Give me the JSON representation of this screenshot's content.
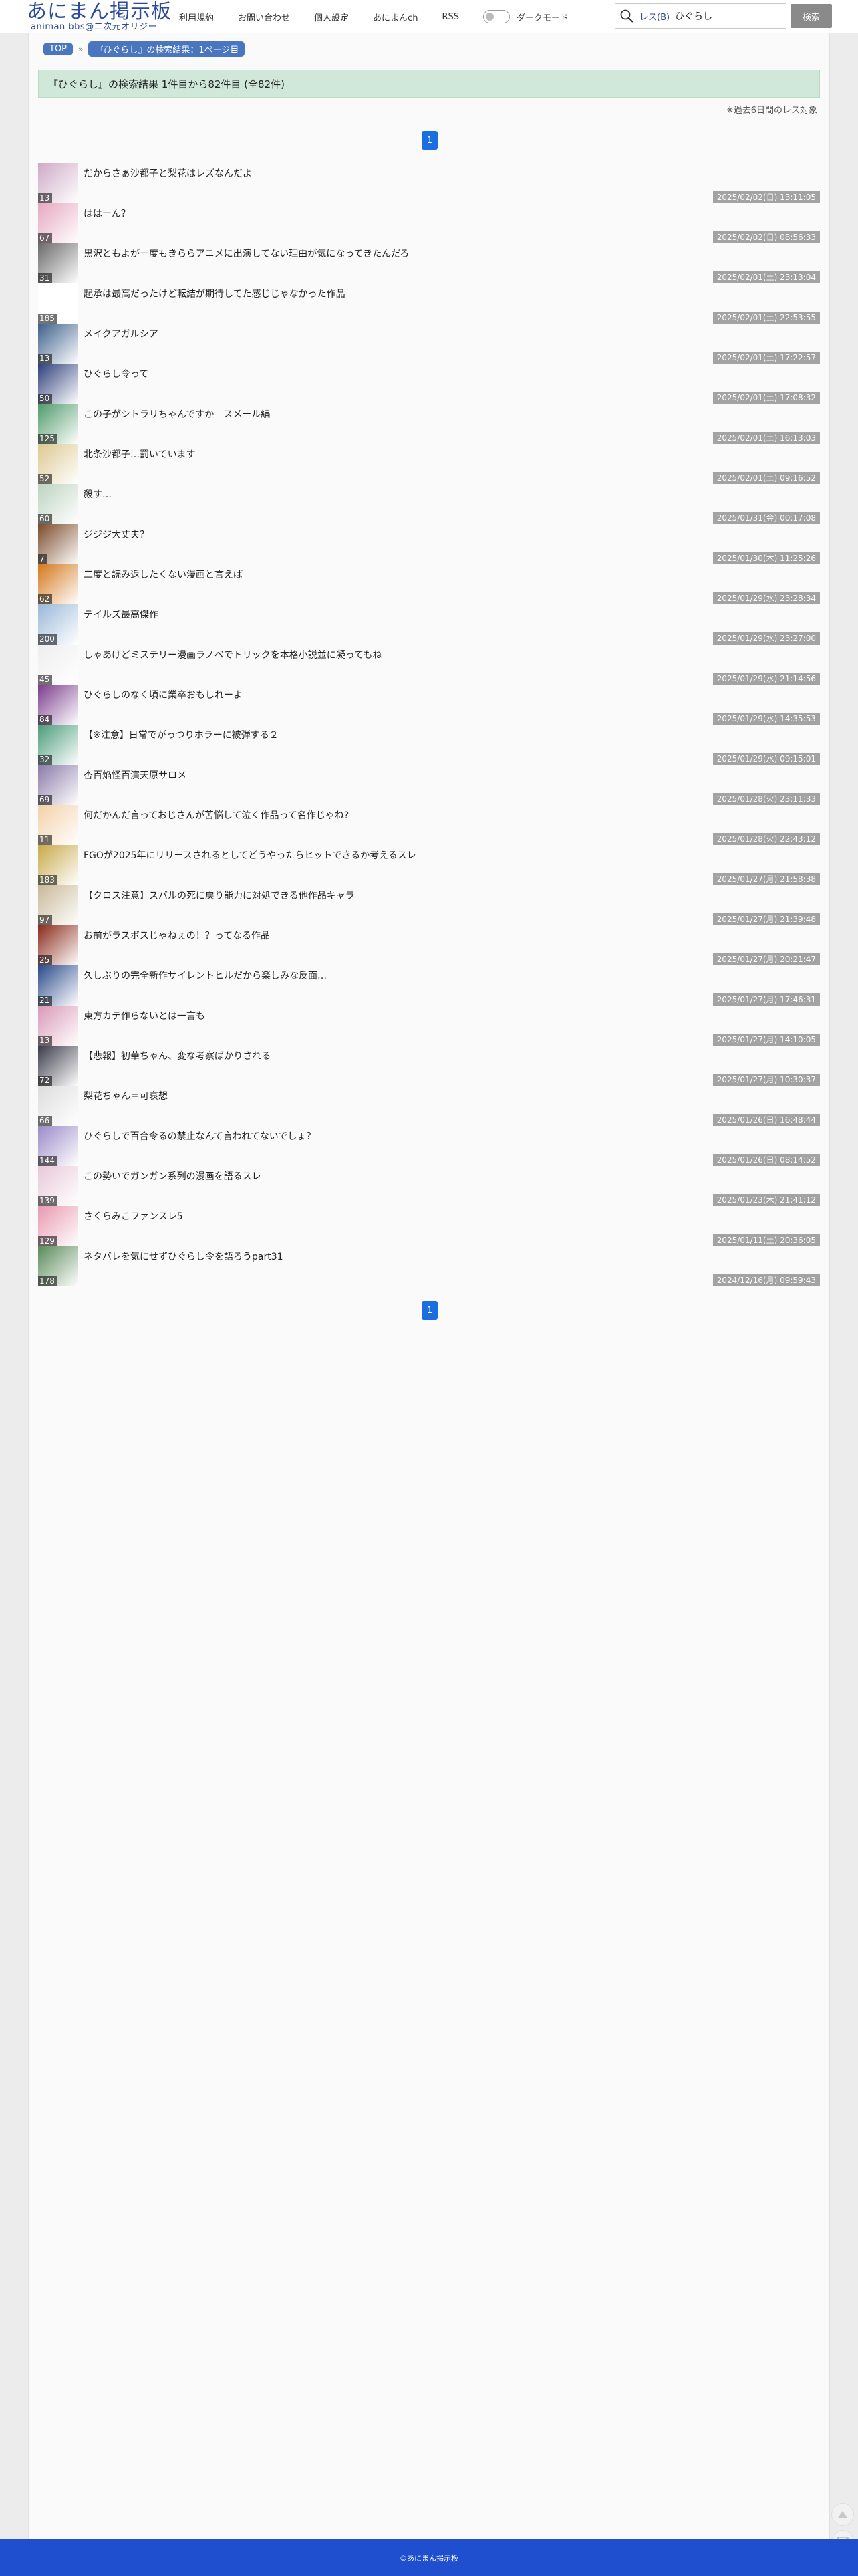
{
  "header": {
    "logo_main": "あにまん掲示板",
    "logo_sub": "animan bbs@二次元オリジー",
    "nav": [
      "利用規約",
      "お問い合わせ",
      "個人設定",
      "あにまんch",
      "RSS"
    ],
    "dark_mode_label": "ダークモード",
    "search_scope": "レス(B)",
    "search_value": "ひぐらし",
    "search_button": "検索"
  },
  "breadcrumb": {
    "top": "TOP",
    "separator": "»",
    "current": "『ひぐらし』の検索結果：1ページ目"
  },
  "results": {
    "header": "『ひぐらし』の検索結果 1件目から82件目 (全82件)",
    "note": "※過去6日間のレス対象",
    "page": "1"
  },
  "threads": [
    {
      "title": "だからさぁ沙都子と梨花はレズなんだよ",
      "count": "13",
      "date": "2025/02/02(日) 13:11:05",
      "color": "#cfa9c7"
    },
    {
      "title": "ははーん？",
      "count": "67",
      "date": "2025/02/02(日) 08:56:33",
      "color": "#e6a8c0"
    },
    {
      "title": "黒沢ともよが一度もきららアニメに出演してない理由が気になってきたんだろ",
      "count": "31",
      "date": "2025/02/01(土) 23:13:04",
      "color": "#6a6a6a"
    },
    {
      "title": "起承は最高だったけど転結が期待してた感じじゃなかった作品",
      "count": "185",
      "date": "2025/02/01(土) 22:53:55",
      "color": "#ffffff"
    },
    {
      "title": "メイクアガルシア",
      "count": "13",
      "date": "2025/02/01(土) 17:22:57",
      "color": "#3c5f8a"
    },
    {
      "title": "ひぐらし令って",
      "count": "50",
      "date": "2025/02/01(土) 17:08:32",
      "color": "#2d3f7a"
    },
    {
      "title": "この子がシトラリちゃんですか　スメール編",
      "count": "125",
      "date": "2025/02/01(土) 16:13:03",
      "color": "#4f9a6a"
    },
    {
      "title": "北条沙都子…罰いています",
      "count": "52",
      "date": "2025/02/01(土) 09:16:52",
      "color": "#dcc890"
    },
    {
      "title": "殺す…",
      "count": "60",
      "date": "2025/01/31(金) 00:17:08",
      "color": "#bcd4c0"
    },
    {
      "title": "ジジジ大丈夫？",
      "count": "7",
      "date": "2025/01/30(木) 11:25:26",
      "color": "#7a4a2a"
    },
    {
      "title": "二度と読み返したくない漫画と言えば",
      "count": "62",
      "date": "2025/01/29(水) 23:28:34",
      "color": "#d4781a"
    },
    {
      "title": "テイルズ最高傑作",
      "count": "200",
      "date": "2025/01/29(水) 23:27:00",
      "color": "#9ab8d8"
    },
    {
      "title": "しゃあけどミステリー漫画ラノベでトリックを本格小説並に凝ってもね",
      "count": "45",
      "date": "2025/01/29(水) 21:14:56",
      "color": "#eeeeee"
    },
    {
      "title": "ひぐらしのなく頃に業卒おもしれーよ",
      "count": "84",
      "date": "2025/01/29(水) 14:35:53",
      "color": "#7a3c8c"
    },
    {
      "title": "【※注意】日常でがっつりホラーに被弾する２",
      "count": "32",
      "date": "2025/01/29(水) 09:15:01",
      "color": "#4a9a7a"
    },
    {
      "title": "杏百焔怪百演天原サロメ",
      "count": "69",
      "date": "2025/01/28(火) 23:11:33",
      "color": "#8a7aa8"
    },
    {
      "title": "何だかんだ言っておじさんが苦悩して泣く作品って名作じゃね?",
      "count": "11",
      "date": "2025/01/28(火) 22:43:12",
      "color": "#f4d0a8"
    },
    {
      "title": "FGOが2025年にリリースされるとしてどうやったらヒットできるか考えるスレ",
      "count": "183",
      "date": "2025/01/27(月) 21:58:38",
      "color": "#c8a848"
    },
    {
      "title": "【クロス注意】スバルの死に戻り能力に対処できる他作品キャラ",
      "count": "97",
      "date": "2025/01/27(月) 21:39:48",
      "color": "#c8b898"
    },
    {
      "title": "お前がラスボスじゃねぇの！？ってなる作品",
      "count": "25",
      "date": "2025/01/27(月) 20:21:47",
      "color": "#8a2a1a"
    },
    {
      "title": "久しぶりの完全新作サイレントヒルだから楽しみな反面…",
      "count": "21",
      "date": "2025/01/27(月) 17:46:31",
      "color": "#2a4a8a"
    },
    {
      "title": "東方カテ作らないとは一言も",
      "count": "13",
      "date": "2025/01/27(月) 14:10:05",
      "color": "#d898b8"
    },
    {
      "title": "【悲報】初華ちゃん、変な考察ばかりされる",
      "count": "72",
      "date": "2025/01/27(月) 10:30:37",
      "color": "#3a3a48"
    },
    {
      "title": "梨花ちゃん＝可哀想",
      "count": "66",
      "date": "2025/01/26(日) 16:48:44",
      "color": "#dddddd"
    },
    {
      "title": "ひぐらしで百合令るの禁止なんて言われてないでしょ？",
      "count": "144",
      "date": "2025/01/26(日) 08:14:52",
      "color": "#9a8ac8"
    },
    {
      "title": "この勢いでガンガン系列の漫画を語るスレ",
      "count": "139",
      "date": "2025/01/23(木) 21:41:12",
      "color": "#e8c8d8"
    },
    {
      "title": "さくらみこファンスレ5",
      "count": "129",
      "date": "2025/01/11(土) 20:36:05",
      "color": "#e898b0"
    },
    {
      "title": "ネタバレを気にせずひぐらし令を語ろうpart31",
      "count": "178",
      "date": "2024/12/16(月) 09:59:43",
      "color": "#5a8a5a"
    }
  ],
  "footer": "©あにまん掲示板"
}
